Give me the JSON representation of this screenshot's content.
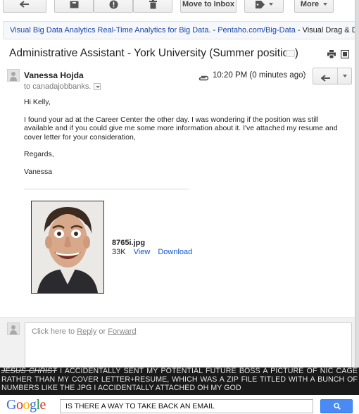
{
  "toolbar": {
    "move_to_inbox_label": "Move to Inbox",
    "more_label": "More",
    "icons": [
      "back-arrow-icon",
      "archive-icon",
      "spam-icon",
      "trash-icon",
      "label-tag-icon"
    ]
  },
  "ad": {
    "link_text": "Visual Big Data Analytics Real-Time Analytics for Big Data.",
    "dash": "-",
    "url_text": "Pentaho.com/Big-Data",
    "rest_text": "- Visual Drag & Drop U"
  },
  "email": {
    "subject": "Administrative Assistant - York University (Summer position)",
    "sender_name": "Vanessa Hojda",
    "to_text": "to canadajobbanks.",
    "time": "10:20 PM (0 minutes ago)",
    "body": {
      "greeting": "Hi Kelly,",
      "paragraph": "I found your ad at the Career Center the other day. I was wondering if the position was still available and if you could give me some more information about it. I've attached my resume and cover letter for your consideration,",
      "closing": "Regards,",
      "signature": "Vanessa"
    },
    "attachment": {
      "filename": "8765i.jpg",
      "size": "33K",
      "view_label": "View",
      "download_label": "Download"
    }
  },
  "reply": {
    "prefix": "Click here to ",
    "reply_label": "Reply",
    "or_text": " or ",
    "forward_label": "Forward"
  },
  "caption": {
    "strike_text": "JESUS CHRIST",
    "text": " I ACCIDENTALLY SENT MY POTENTIAL FUTURE BOSS A PICTURE OF NIC CAGE RATHER THAN MY COVER LETTER+RESUME, WHICH WAS A ZIP FILE TITLED WITH A BUNCH OF NUMBERS LIKE THE JPG I ACCIDENTALLY ATTACHED OH MY GOD"
  },
  "google": {
    "logo_letters": [
      "G",
      "o",
      "o",
      "g",
      "l",
      "e"
    ],
    "search_value": "IS THERE A WAY TO TAKE BACK AN EMAIL"
  },
  "colors": {
    "link_blue": "#1155cc",
    "ad_link": "#1a47a8",
    "google_blue": "#4a8af4",
    "caption_bg": "#1a1a1a"
  }
}
